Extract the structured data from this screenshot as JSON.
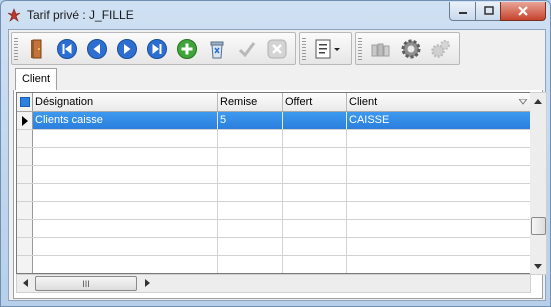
{
  "window": {
    "title": "Tarif privé : J_FILLE"
  },
  "toolbar": {
    "buttons": [
      {
        "name": "exit-door-icon"
      },
      {
        "name": "first-record-icon"
      },
      {
        "name": "previous-record-icon"
      },
      {
        "name": "next-record-icon"
      },
      {
        "name": "last-record-icon"
      },
      {
        "name": "add-record-icon"
      },
      {
        "name": "delete-record-icon"
      },
      {
        "name": "validate-check-icon"
      },
      {
        "name": "cancel-x-icon"
      },
      {
        "name": "document-menu-icon"
      },
      {
        "name": "books-icon"
      },
      {
        "name": "settings-gear-icon"
      },
      {
        "name": "settings-gears-icon"
      }
    ]
  },
  "tabs": {
    "client": "Client"
  },
  "grid": {
    "columns": [
      "Désignation",
      "Remise",
      "Offert",
      "Client"
    ],
    "rows": [
      {
        "designation": "Clients caisse",
        "remise": "5",
        "offert": "",
        "client": "CAISSE"
      }
    ]
  },
  "scrollbar": {
    "grip": "III"
  },
  "colors": {
    "selection": "#3390ee",
    "close_button": "#c6432d"
  }
}
